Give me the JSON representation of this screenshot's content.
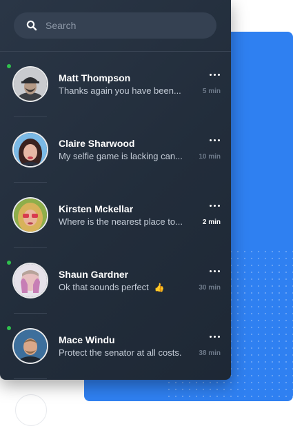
{
  "search": {
    "placeholder": "Search",
    "icon": "search-icon"
  },
  "contacts": [
    {
      "name": "Matt Thompson",
      "message": "Thanks again you have been...",
      "time": "5 min",
      "online": true,
      "unread": false,
      "reaction": ""
    },
    {
      "name": "Claire Sharwood",
      "message": "My selfie game is lacking can...",
      "time": "10 min",
      "online": false,
      "unread": false,
      "reaction": ""
    },
    {
      "name": "Kirsten Mckellar",
      "message": "Where is the nearest place to...",
      "time": "2 min",
      "online": false,
      "unread": true,
      "reaction": ""
    },
    {
      "name": "Shaun Gardner",
      "message": "Ok that sounds perfect",
      "time": "30 min",
      "online": true,
      "unread": false,
      "reaction": "👍"
    },
    {
      "name": "Mace Windu",
      "message": "Protect the senator at all costs.",
      "time": "38 min",
      "online": true,
      "unread": false,
      "reaction": ""
    }
  ],
  "colors": {
    "accent": "#2f80f1",
    "panel": "#222d3b",
    "online": "#2fc14d",
    "search_bg": "#354152"
  }
}
